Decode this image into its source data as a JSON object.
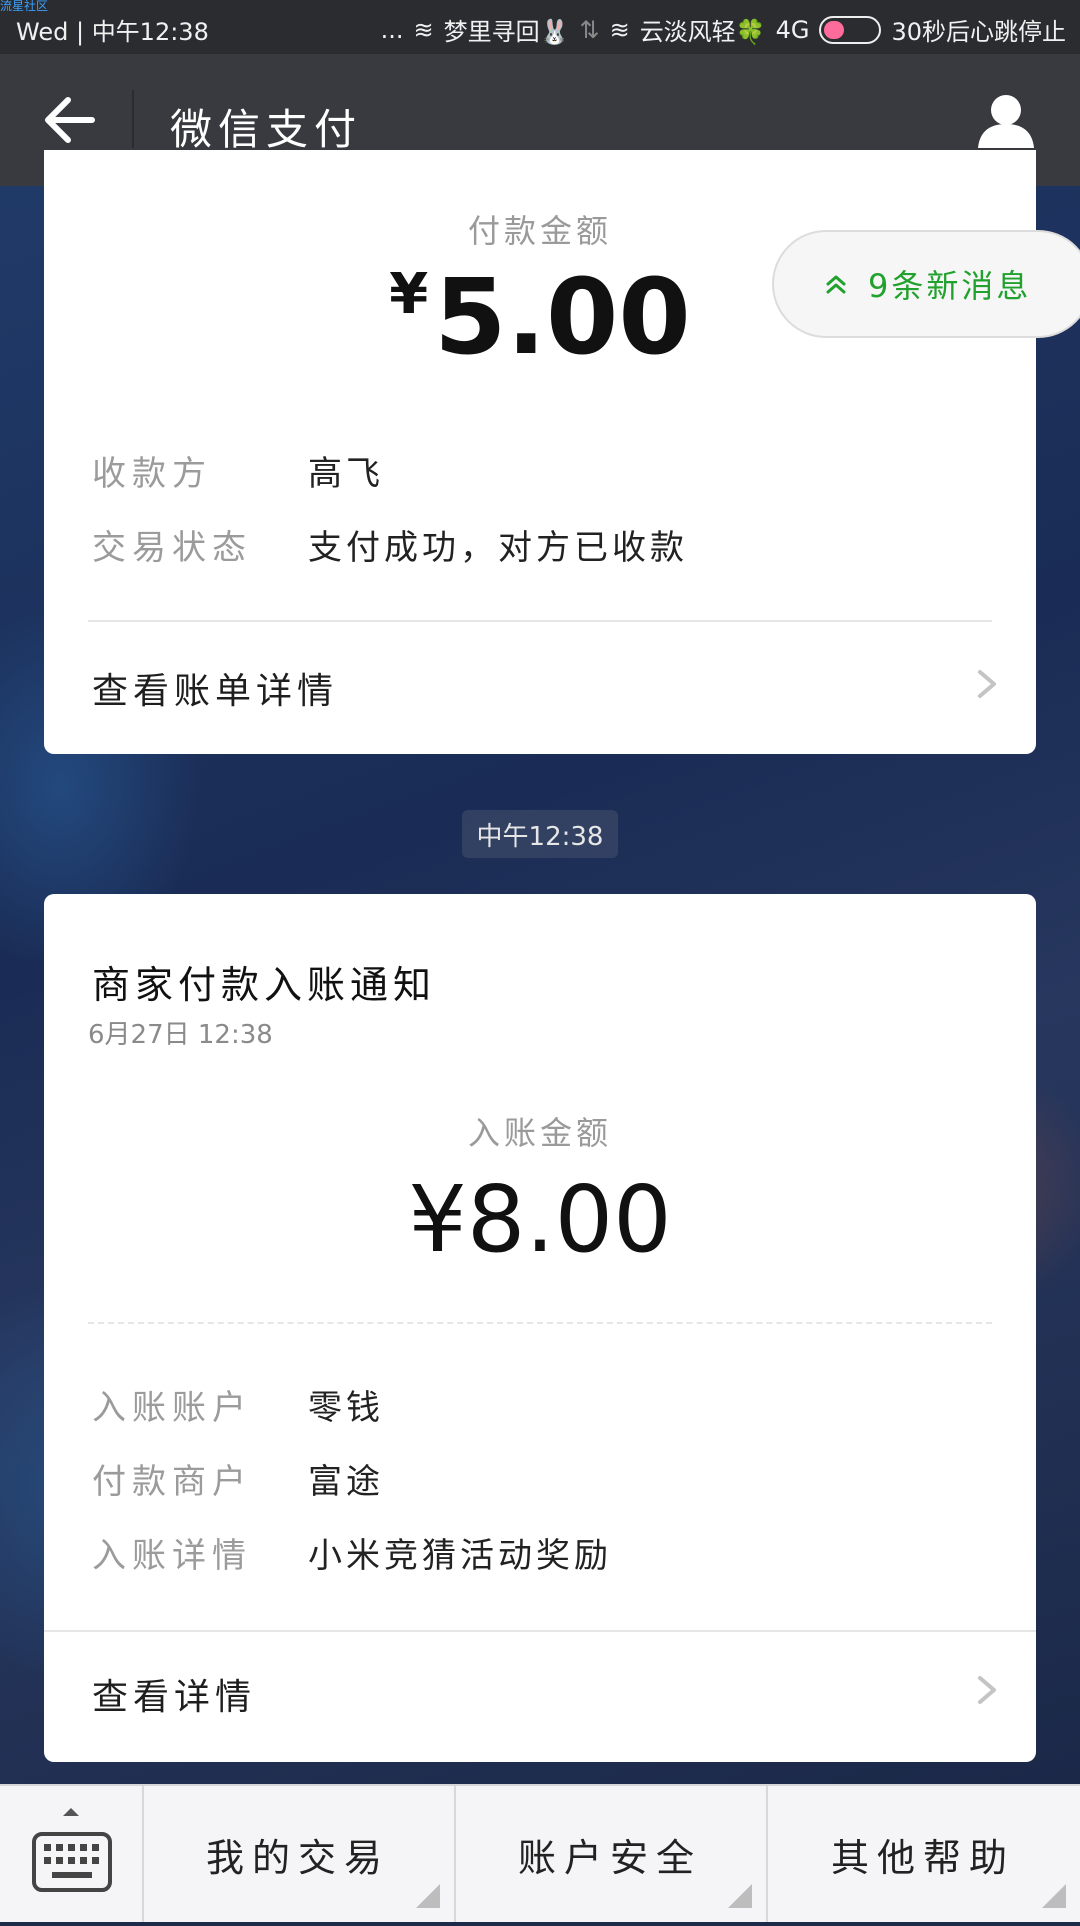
{
  "watermark": "流星社区",
  "status_bar": {
    "day": "Wed",
    "time": "中午12:38",
    "dots": "...",
    "net1": "梦里寻回🐰",
    "arrows": "⇅",
    "net2": "云淡风轻🍀",
    "signal": "4G",
    "toggle_text": "30秒后心跳停止"
  },
  "title_bar": {
    "title": "微信支付"
  },
  "new_messages": "9条新消息",
  "card1": {
    "amount_caption": "付款金额",
    "currency": "¥",
    "amount": "5.00",
    "rows": [
      {
        "label": "收款方",
        "value": "高飞"
      },
      {
        "label": "交易状态",
        "value": "支付成功，对方已收款"
      }
    ],
    "link": "查看账单详情"
  },
  "time_chip": "中午12:38",
  "card2": {
    "title": "商家付款入账通知",
    "date": "6月27日 12:38",
    "amount_caption": "入账金额",
    "amount": "¥8.00",
    "rows": [
      {
        "label": "入账账户",
        "value": "零钱"
      },
      {
        "label": "付款商户",
        "value": "富途"
      },
      {
        "label": "入账详情",
        "value": "小米竞猜活动奖励"
      }
    ],
    "link": "查看详情"
  },
  "bottom_menu": {
    "items": [
      "我的交易",
      "账户安全",
      "其他帮助"
    ]
  }
}
